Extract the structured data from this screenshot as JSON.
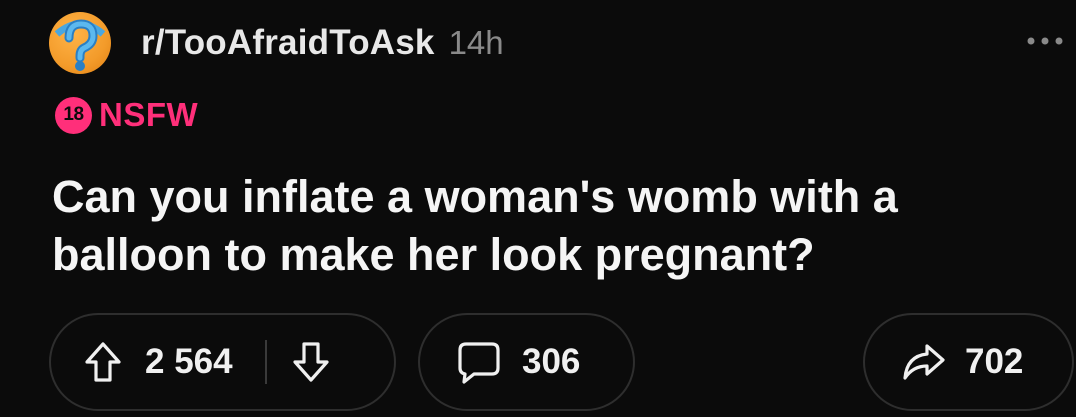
{
  "post": {
    "subreddit": "r/TooAfraidToAsk",
    "time_ago": "14h",
    "nsfw_age": "18",
    "nsfw_label": "NSFW",
    "title": "Can you inflate a woman's womb with a balloon to make her look pregnant?"
  },
  "actions": {
    "upvotes": "2 564",
    "comments": "306",
    "shares": "702"
  },
  "icons": {
    "avatar": "question-mark-subreddit-icon",
    "more": "more-options-icon",
    "upvote": "upvote-arrow-icon",
    "downvote": "downvote-arrow-icon",
    "comment": "comment-bubble-icon",
    "share": "share-arrow-icon"
  },
  "colors": {
    "background": "#0b0b0b",
    "nsfw": "#ff2f7a",
    "muted": "#8a8a8a",
    "pill_border": "#2e2e2e"
  }
}
